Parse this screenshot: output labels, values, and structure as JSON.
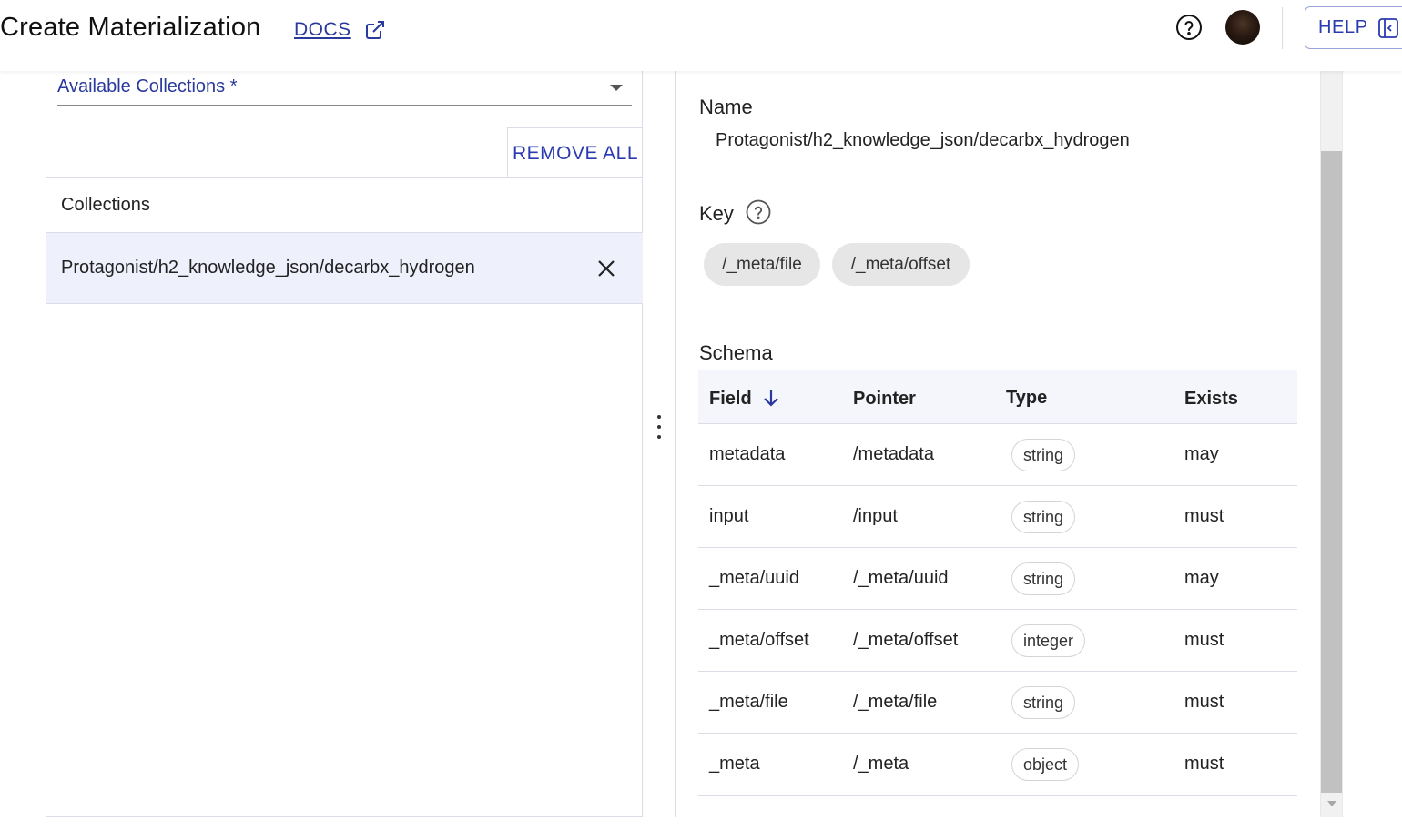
{
  "header": {
    "title": "Create Materialization",
    "docs_label": "DOCS",
    "help_label": "HELP"
  },
  "left": {
    "available_collections_label": "Available Collections *",
    "remove_all_label": "REMOVE ALL",
    "collections_header": "Collections",
    "collections": [
      "Protagonist/h2_knowledge_json/decarbx_hydrogen"
    ]
  },
  "right": {
    "name_label": "Name",
    "name_value": "Protagonist/h2_knowledge_json/decarbx_hydrogen",
    "key_label": "Key",
    "keys": [
      "/_meta/file",
      "/_meta/offset"
    ],
    "schema_label": "Schema",
    "columns": [
      "Field",
      "Pointer",
      "Type",
      "Exists"
    ],
    "rows": [
      {
        "field": "metadata",
        "pointer": "/metadata",
        "type": "string",
        "exists": "may"
      },
      {
        "field": "input",
        "pointer": "/input",
        "type": "string",
        "exists": "must"
      },
      {
        "field": "_meta/uuid",
        "pointer": "/_meta/uuid",
        "type": "string",
        "exists": "may"
      },
      {
        "field": "_meta/offset",
        "pointer": "/_meta/offset",
        "type": "integer",
        "exists": "must"
      },
      {
        "field": "_meta/file",
        "pointer": "/_meta/file",
        "type": "string",
        "exists": "must"
      },
      {
        "field": "_meta",
        "pointer": "/_meta",
        "type": "object",
        "exists": "must"
      }
    ]
  },
  "icons": {
    "docs": "external-link-icon",
    "help_circle": "help-circle-icon",
    "help_button": "sidebar-panel-icon",
    "remove_collection": "close-icon",
    "sort": "arrow-down-icon",
    "splitter": "drag-handle-icon"
  },
  "colors": {
    "accent": "#2a3ab0",
    "selected_row": "#eef1fb",
    "chip_bg": "#e6e6e6"
  }
}
